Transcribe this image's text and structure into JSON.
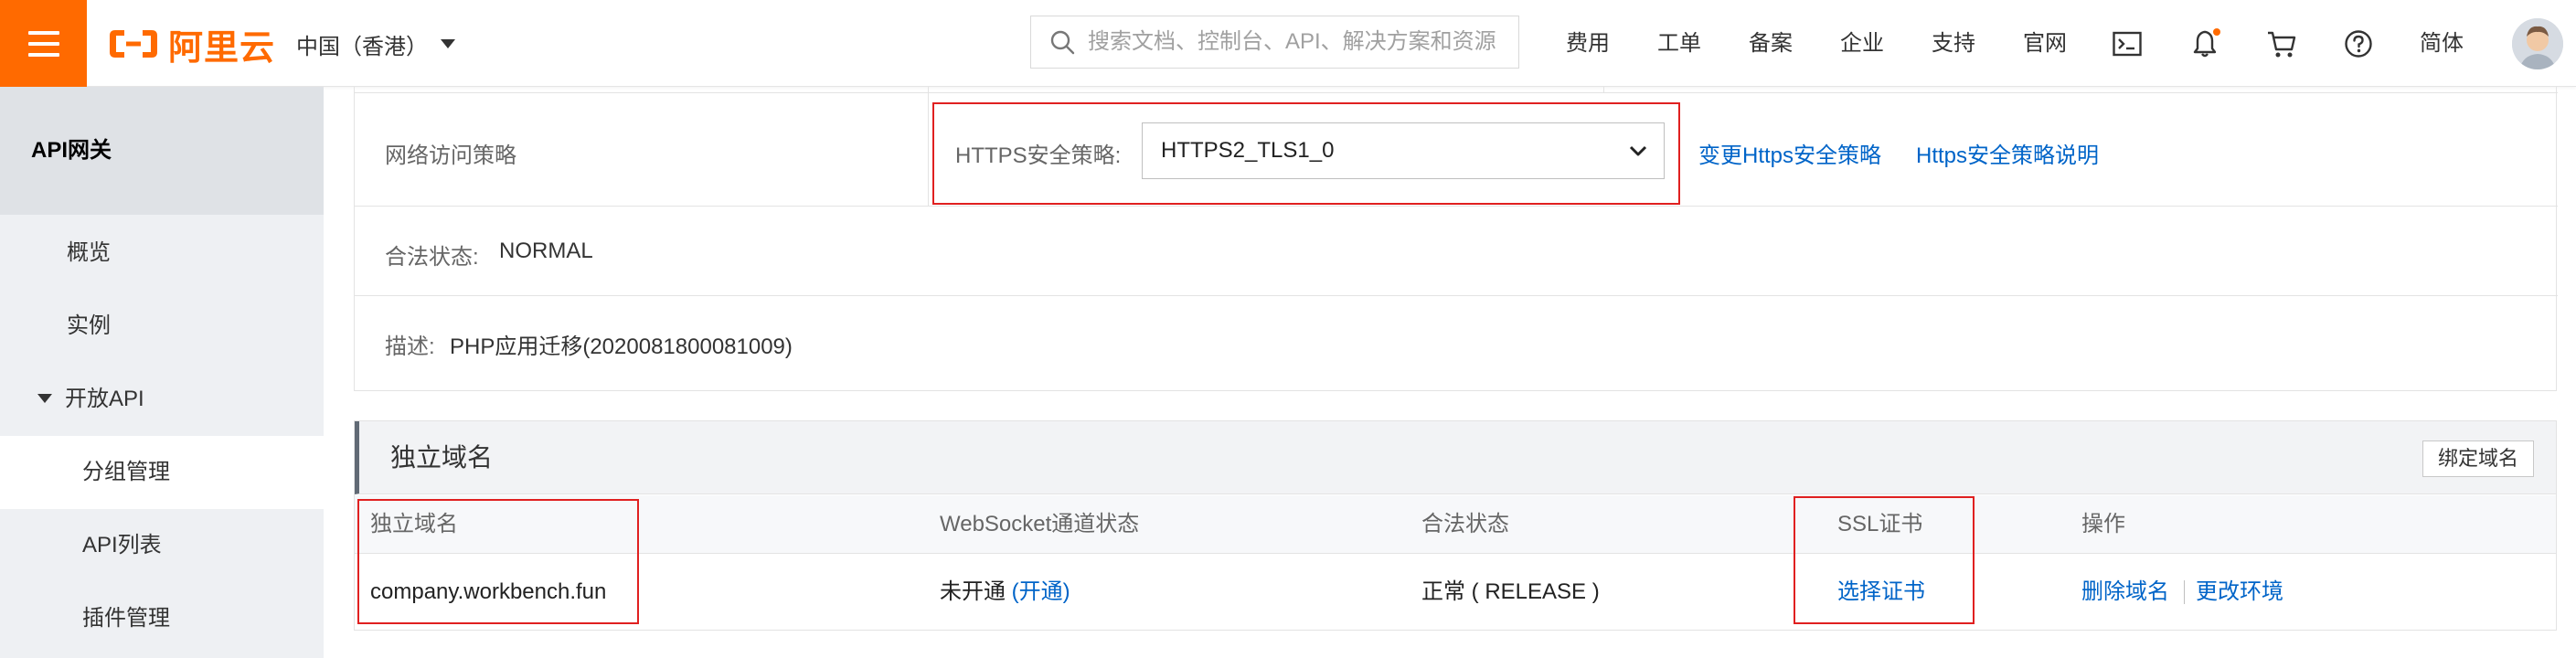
{
  "header": {
    "logo_text": "阿里云",
    "region": "中国（香港）",
    "search_placeholder": "搜索文档、控制台、API、解决方案和资源",
    "nav": [
      "费用",
      "工单",
      "备案",
      "企业",
      "支持",
      "官网"
    ],
    "language": "简体",
    "brand_color": "#ff6a00"
  },
  "sidebar": {
    "title": "API网关",
    "items": [
      {
        "label": "概览",
        "active": false
      },
      {
        "label": "实例",
        "active": false
      },
      {
        "label": "开放API",
        "active": false,
        "expanded": true
      },
      {
        "label": "分组管理",
        "active": true
      },
      {
        "label": "API列表",
        "active": false
      },
      {
        "label": "插件管理",
        "active": false
      }
    ]
  },
  "info": {
    "network_policy_label": "网络访问策略",
    "https_policy_label": "HTTPS安全策略:",
    "https_policy_value": "HTTPS2_TLS1_0",
    "change_policy_link": "变更Https安全策略",
    "policy_doc_link": "Https安全策略说明",
    "legal_status_label": "合法状态:",
    "legal_status_value": "NORMAL",
    "description_label": "描述:",
    "description_value": "PHP应用迁移(2020081800081009)"
  },
  "domains": {
    "title": "独立域名",
    "bind_button": "绑定域名",
    "columns": [
      "独立域名",
      "WebSocket通道状态",
      "合法状态",
      "SSL证书",
      "操作"
    ],
    "rows": [
      {
        "domain": "company.workbench.fun",
        "websocket_status": "未开通",
        "websocket_action": "(开通)",
        "legal_status": "正常 ( RELEASE )",
        "ssl_action": "选择证书",
        "delete_action": "删除域名",
        "change_env_action": "更改环境"
      }
    ]
  },
  "colors": {
    "link": "#0064c8",
    "highlight_box": "#e02020"
  }
}
